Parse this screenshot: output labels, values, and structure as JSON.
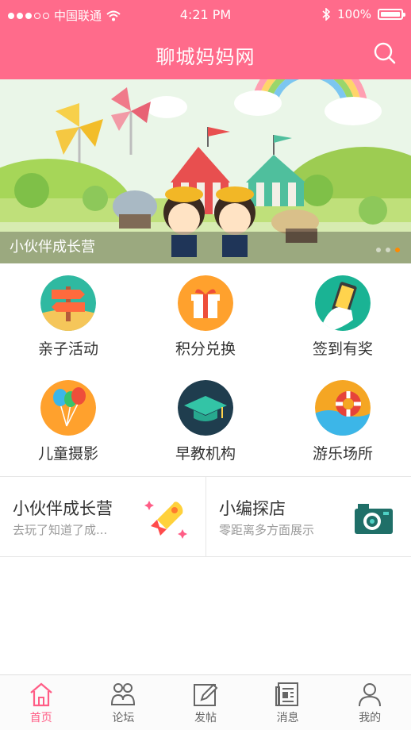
{
  "status": {
    "carrier": "中国联通",
    "time": "4:21 PM",
    "battery": "100%"
  },
  "header": {
    "title": "聊城妈妈网"
  },
  "banner": {
    "caption": "小伙伴成长营"
  },
  "grid": {
    "items": [
      {
        "label": "亲子活动",
        "icon": "signpost-icon"
      },
      {
        "label": "积分兑换",
        "icon": "gift-icon"
      },
      {
        "label": "签到有奖",
        "icon": "phone-hand-icon"
      },
      {
        "label": "儿童摄影",
        "icon": "balloons-icon"
      },
      {
        "label": "早教机构",
        "icon": "graduation-cap-icon"
      },
      {
        "label": "游乐场所",
        "icon": "lifebuoy-icon"
      }
    ]
  },
  "cards": [
    {
      "title": "小伙伴成长营",
      "subtitle": "去玩了知道了成...",
      "icon": "rocket-icon"
    },
    {
      "title": "小编探店",
      "subtitle": "零距离多方面展示",
      "icon": "camera-icon"
    }
  ],
  "tabs": [
    {
      "label": "首页",
      "icon": "home-icon",
      "active": true
    },
    {
      "label": "论坛",
      "icon": "forum-icon",
      "active": false
    },
    {
      "label": "发帖",
      "icon": "post-icon",
      "active": false
    },
    {
      "label": "消息",
      "icon": "message-icon",
      "active": false
    },
    {
      "label": "我的",
      "icon": "profile-icon",
      "active": false
    }
  ],
  "colors": {
    "brand": "#ff6b8b",
    "tab_active": "#ff5d86"
  }
}
